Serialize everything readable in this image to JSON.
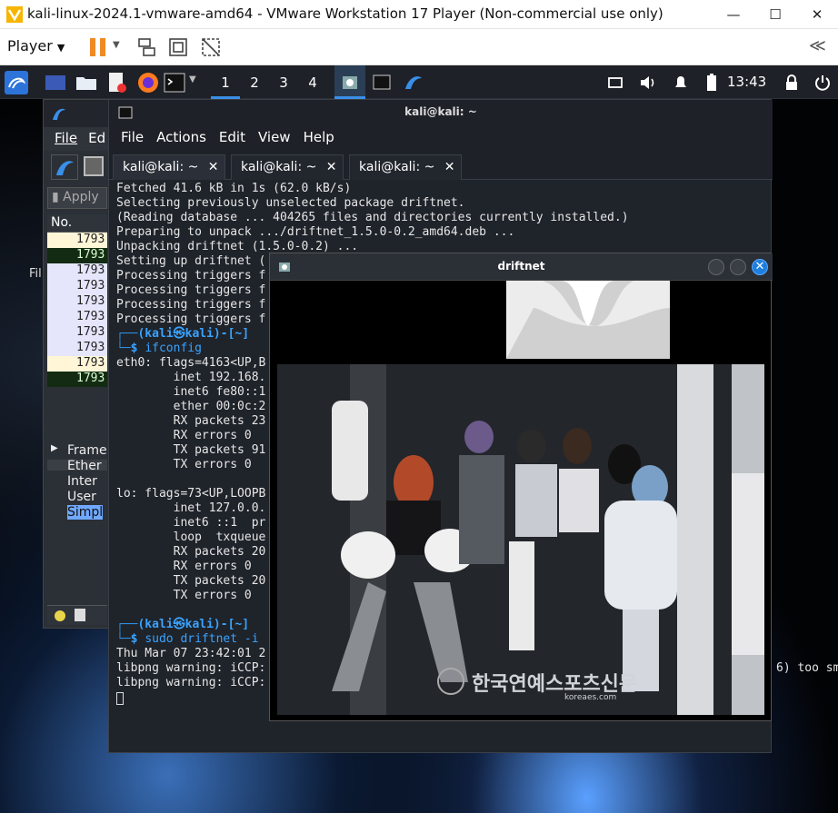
{
  "vmware": {
    "title": "kali-linux-2024.1-vmware-amd64 - VMware Workstation 17 Player (Non-commercial use only)",
    "player_label": "Player",
    "minimize": "—",
    "maximize": "☐",
    "close": "✕",
    "collapse": "≪"
  },
  "panel": {
    "workspaces": [
      "1",
      "2",
      "3",
      "4"
    ],
    "clock": "13:43"
  },
  "wireshark": {
    "menu": [
      "File",
      "Ed"
    ],
    "apply_label": "Apply",
    "col_no": "No.",
    "rows": [
      "1793",
      "1793",
      "1793",
      "1793",
      "1793",
      "1793",
      "1793",
      "1793",
      "1793",
      "1793"
    ],
    "tree": [
      "Frame",
      "Ether",
      "Inter",
      "User",
      "Simpl"
    ],
    "side_label": "Fil"
  },
  "terminal": {
    "title": "kali@kali: ~",
    "menu": [
      "File",
      "Actions",
      "Edit",
      "View",
      "Help"
    ],
    "tabs": [
      {
        "label": "kali@kali: ~",
        "close": "✕"
      },
      {
        "label": "kali@kali: ~",
        "close": "✕"
      },
      {
        "label": "kali@kali: ~",
        "close": "✕"
      }
    ],
    "lines": [
      "Fetched 41.6 kB in 1s (62.0 kB/s)",
      "Selecting previously unselected package driftnet.",
      "(Reading database ... 404265 files and directories currently installed.)",
      "Preparing to unpack .../driftnet_1.5.0-0.2_amd64.deb ...",
      "Unpacking driftnet (1.5.0-0.2) ...",
      "Setting up driftnet (",
      "Processing triggers f",
      "Processing triggers f",
      "Processing triggers f",
      "Processing triggers f"
    ],
    "prompt_user": "(kali㉿kali)-[~]",
    "cmd1": "ifconfig",
    "ifconfig": [
      "eth0: flags=4163<UP,B",
      "        inet 192.168.",
      "        inet6 fe80::1",
      "        ether 00:0c:2",
      "        RX packets 23",
      "        RX errors 0",
      "        TX packets 91",
      "        TX errors 0",
      "",
      "lo: flags=73<UP,LOOPB",
      "        inet 127.0.0.",
      "        inet6 ::1  pr",
      "        loop  txqueue",
      "        RX packets 20",
      "        RX errors 0",
      "        TX packets 20",
      "        TX errors 0"
    ],
    "cmd2": "sudo driftnet -i",
    "tail": [
      "Thu Mar 07 23:42:01 2",
      "libpng warning: iCCP:",
      "libpng warning: iCCP:"
    ],
    "tail_right": "6) too sm"
  },
  "driftnet": {
    "title": "driftnet",
    "close": "✕",
    "watermark": "한국연예스포츠신문",
    "watermark_sub": "koreaes.com"
  }
}
